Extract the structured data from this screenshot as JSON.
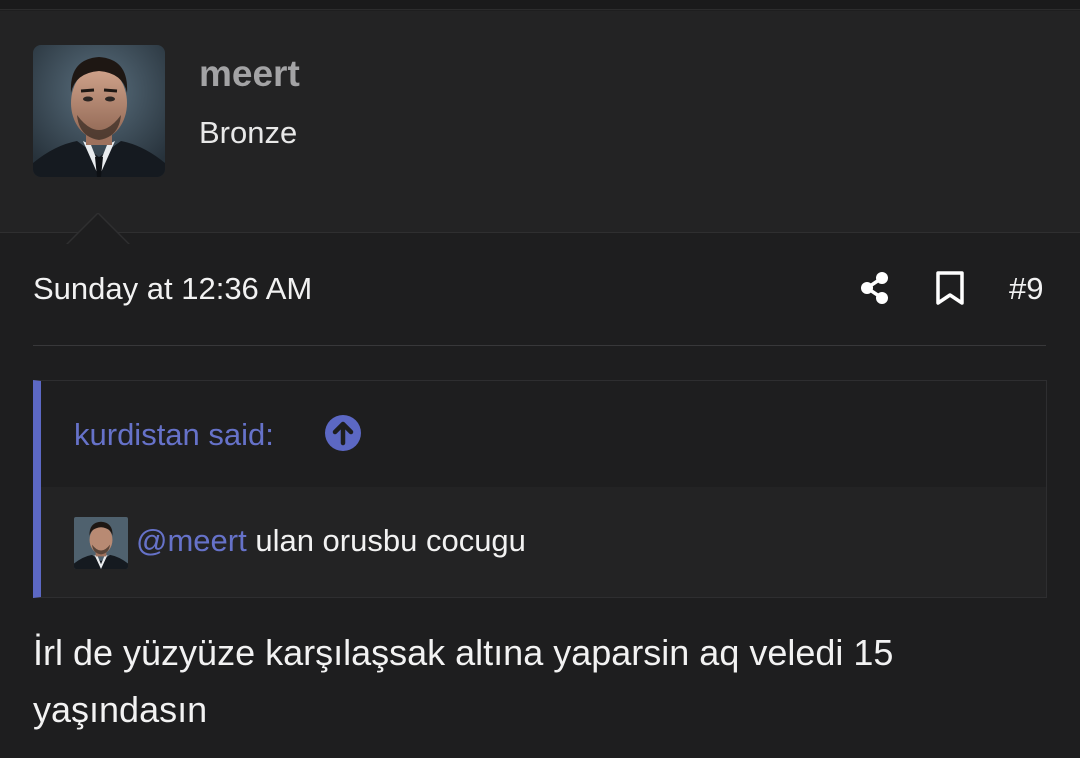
{
  "message": {
    "author": {
      "username": "meert",
      "title": "Bronze",
      "avatar_icon": "user-portrait-avatar"
    },
    "date": "Sunday at 12:36 AM",
    "actions": {
      "share_icon": "share-icon",
      "bookmark_icon": "bookmark-icon",
      "post_number": "#9"
    },
    "quote": {
      "author_said": "kurdistan said:",
      "arrow_icon": "arrow-up-circle-icon",
      "mention": "@meert",
      "text": " ulan orusbu cocugu"
    },
    "body": "İrl de yüzyüze karşılaşsak altına yaparsin aq veledi 15 yaşındasın"
  },
  "colors": {
    "background": "#1e1e1f",
    "panel": "#232324",
    "accent": "#5c68c4",
    "link": "#6672c9",
    "muted_username": "#a3a3a5"
  }
}
